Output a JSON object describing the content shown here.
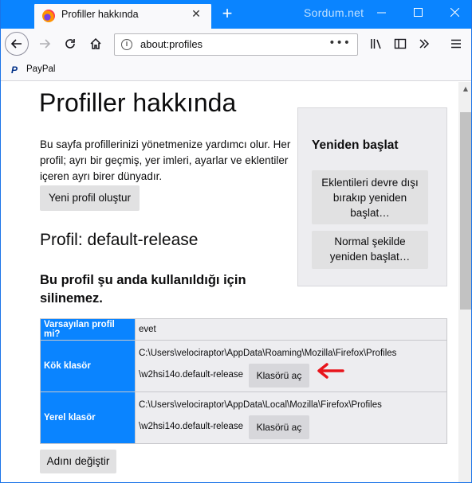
{
  "browser": {
    "tab_title": "Profiller hakkında",
    "tab_close": "✕",
    "new_tab": "+",
    "watermark": "Sordum.net",
    "url": "about:profiles",
    "url_actions": "•••",
    "bookmark_icon": "P",
    "bookmark_label": "PayPal",
    "colors": {
      "titlebar": "#0a84ff",
      "accent": "#0a84ff"
    }
  },
  "page": {
    "title": "Profiller hakkında",
    "intro": "Bu sayfa profillerinizi yönetmenize yardımcı olur. Her profil; ayrı bir geçmiş, yer imleri, ayarlar ve eklentiler içeren ayrı birer dünyadır.",
    "create_button": "Yeni profil oluştur",
    "profile_title": "Profil: default-release",
    "cannot_delete": "Bu profil şu anda kullanıldığı için silinemez.",
    "rows": {
      "default_label": "Varsayılan profil mi?",
      "default_value": "evet",
      "root_label": "Kök klasör",
      "root_line1": "C:\\Users\\velociraptor\\AppData\\Roaming\\Mozilla\\Firefox\\Profiles",
      "root_line2": "\\w2hsi14o.default-release",
      "local_label": "Yerel klasör",
      "local_line1": "C:\\Users\\velociraptor\\AppData\\Local\\Mozilla\\Firefox\\Profiles",
      "local_line2": "\\w2hsi14o.default-release"
    },
    "open_folder": "Klasörü aç",
    "rename_button": "Adını değiştir"
  },
  "restart": {
    "title": "Yeniden başlat",
    "disable_addons": "Eklentileri devre dışı bırakıp yeniden başlat…",
    "normal": "Normal şekilde yeniden başlat…"
  }
}
